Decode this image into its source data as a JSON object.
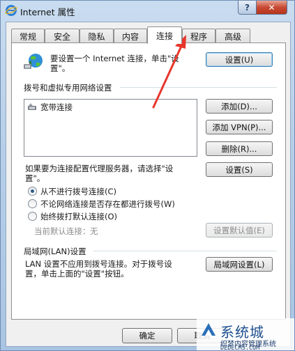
{
  "window": {
    "title": "Internet 属性",
    "help_label": "?",
    "close_label": "✕"
  },
  "tabs": [
    {
      "label": "常规"
    },
    {
      "label": "安全"
    },
    {
      "label": "隐私"
    },
    {
      "label": "内容"
    },
    {
      "label": "连接",
      "active": true
    },
    {
      "label": "程序"
    },
    {
      "label": "高级"
    }
  ],
  "setup": {
    "text_line1": "要设置一个 Internet 连接，单击\"设",
    "text_line2": "置\"。",
    "button": "设置(U)"
  },
  "dialup": {
    "heading": "拨号和虚拟专用网络设置",
    "connections": [
      "宽带连接"
    ],
    "add_button": "添加(D)...",
    "add_vpn_button": "添加 VPN(P)...",
    "delete_button": "删除(R)...",
    "proxy_text_line1": "如果要为连接配置代理服务器，请选择\"设",
    "proxy_text_line2": "置\"。",
    "settings_button": "设置(S)",
    "options": [
      {
        "label": "从不进行拨号连接(C)",
        "checked": true
      },
      {
        "label": "不论网络连接是否存在都进行拨号(W)",
        "checked": false
      },
      {
        "label": "始终拨打默认连接(O)",
        "checked": false
      }
    ],
    "current_default_label": "当前默认连接：",
    "current_default_value": "无",
    "set_default_button": "设置默认值(E)"
  },
  "lan": {
    "heading": "局域网(LAN)设置",
    "text_line1": "LAN 设置不应用到拨号连接。对于拨号设",
    "text_line2": "置，单击上面的\"设置\"按钮。",
    "button": "局域网设置(L)"
  },
  "footer": {
    "ok_button": "确定",
    "cancel_button": "取消"
  },
  "watermark": {
    "line1": "系统城",
    "line2": "织梦内容管理系统",
    "line3": "DEDECMS.COM"
  },
  "colors": {
    "annotation_arrow": "#e8362c"
  }
}
